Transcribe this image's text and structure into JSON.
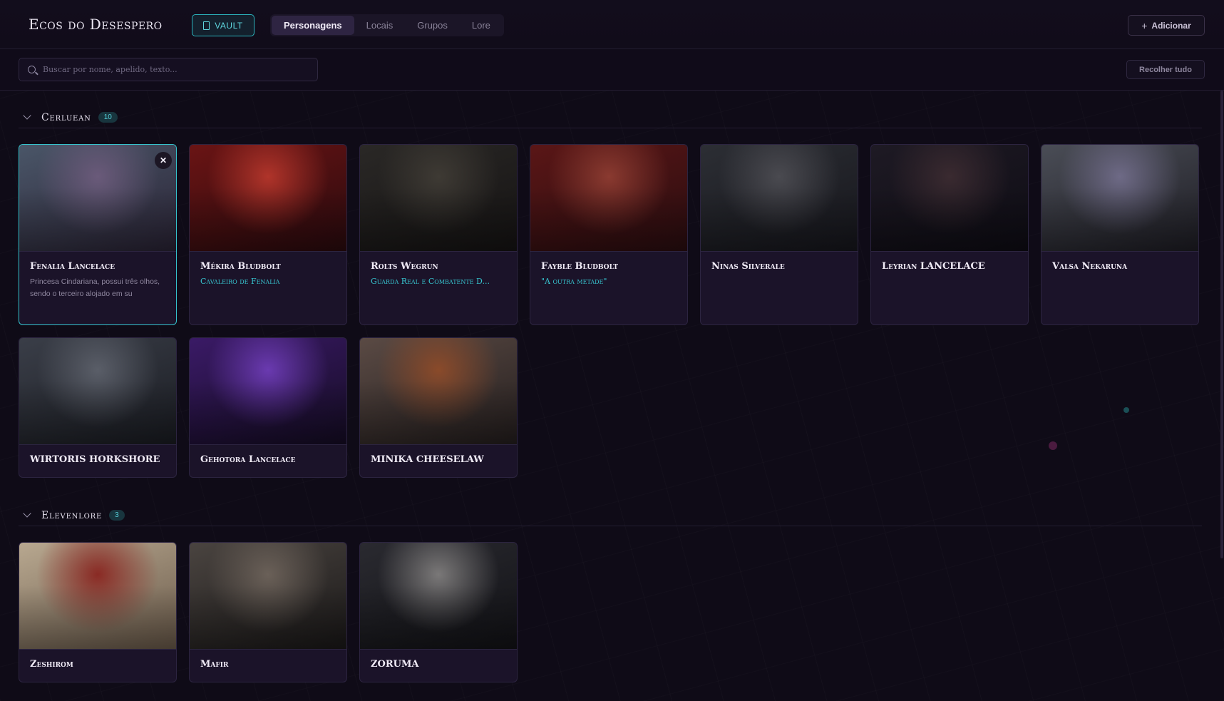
{
  "header": {
    "app_title": "Ecos do Desespero",
    "vault_label": "VAULT",
    "tabs": [
      {
        "label": "Personagens",
        "active": true
      },
      {
        "label": "Locais",
        "active": false
      },
      {
        "label": "Grupos",
        "active": false
      },
      {
        "label": "Lore",
        "active": false
      }
    ],
    "add_label": "Adicionar"
  },
  "toolbar": {
    "search_placeholder": "Buscar por nome, apelido, texto...",
    "collapse_label": "Recolher tudo"
  },
  "groups": [
    {
      "name": "Cerluean",
      "count": "10",
      "cards": [
        {
          "name": "Fenalia Lancelace",
          "subtitle": "",
          "description": "Princesa Cindariana, possui três olhos, sendo o terceiro alojado em su",
          "selected": true,
          "close_label": "✕",
          "colors": [
            "#4a5668",
            "#2a2335",
            "#6a5a7a"
          ]
        },
        {
          "name": "Mékira Bludbolt",
          "subtitle": "Cavaleiro de Fenalia",
          "description": "",
          "selected": false,
          "colors": [
            "#6a1414",
            "#2a0a0e",
            "#b0342a"
          ]
        },
        {
          "name": "Rolts Wegrun",
          "subtitle": "Guarda Real e Combatente D...",
          "description": "",
          "selected": false,
          "colors": [
            "#2a2826",
            "#151313",
            "#3e3a34"
          ]
        },
        {
          "name": "Fayble Bludbolt",
          "subtitle": "\"A outra metade\"",
          "description": "",
          "selected": false,
          "colors": [
            "#5a1616",
            "#2a0d10",
            "#8a3a30"
          ]
        },
        {
          "name": "Ninas Silverale",
          "subtitle": "",
          "description": "",
          "selected": false,
          "colors": [
            "#2c2e34",
            "#16161c",
            "#4a4a50"
          ]
        },
        {
          "name": "Leyrian LANCELACE",
          "subtitle": "",
          "description": "",
          "selected": false,
          "colors": [
            "#1e1a24",
            "#0e0c14",
            "#3a2a30"
          ]
        },
        {
          "name": "Valsa Nekaruna",
          "subtitle": "",
          "description": "",
          "selected": false,
          "colors": [
            "#4a4d56",
            "#1e1d24",
            "#6e6a86"
          ]
        },
        {
          "name": "WIRTORIS HORKSHORE",
          "subtitle": "",
          "description": "",
          "selected": false,
          "colors": [
            "#3a3e48",
            "#1a1c22",
            "#5a5e68"
          ]
        },
        {
          "name": "Gehotora Lancelace",
          "subtitle": "",
          "description": "",
          "selected": false,
          "colors": [
            "#3a1a66",
            "#150c24",
            "#6a3ab0"
          ]
        },
        {
          "name": "MINIKA CHEESELAW",
          "subtitle": "",
          "description": "",
          "selected": false,
          "colors": [
            "#5a4a44",
            "#241e1e",
            "#8a4a2a"
          ]
        }
      ]
    },
    {
      "name": "Elevenlore",
      "count": "3",
      "cards": [
        {
          "name": "Zeshirom",
          "subtitle": "",
          "description": "",
          "selected": false,
          "colors": [
            "#b8a890",
            "#6a5a4a",
            "#8a2a24"
          ]
        },
        {
          "name": "Mafir",
          "subtitle": "",
          "description": "",
          "selected": false,
          "colors": [
            "#4a4440",
            "#1a1818",
            "#6a6058"
          ]
        },
        {
          "name": "ZORUMA",
          "subtitle": "",
          "description": "",
          "selected": false,
          "colors": [
            "#2a2a30",
            "#121216",
            "#7a7878"
          ]
        }
      ]
    }
  ]
}
